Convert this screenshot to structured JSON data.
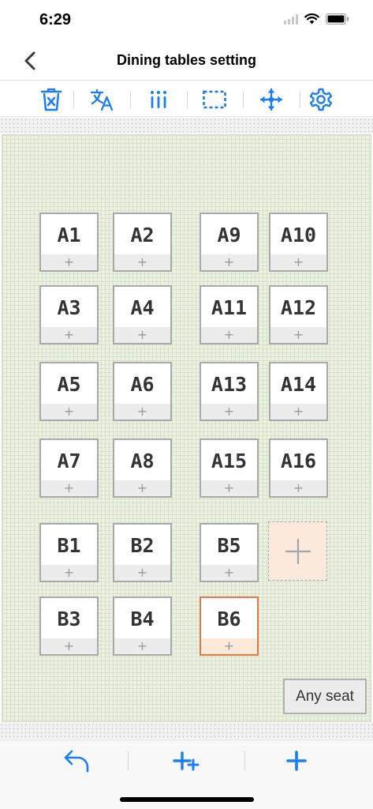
{
  "status_bar": {
    "time": "6:29"
  },
  "nav": {
    "title": "Dining tables setting"
  },
  "toolbar": {
    "tools": [
      {
        "icon": "trash-icon"
      },
      {
        "icon": "translate-icon"
      },
      {
        "icon": "columns-icon"
      },
      {
        "icon": "selection-icon"
      },
      {
        "icon": "move-icon"
      },
      {
        "icon": "gear-icon"
      }
    ]
  },
  "tables": {
    "add_label": "+",
    "items": [
      {
        "name": "A1"
      },
      {
        "name": "A2"
      },
      {
        "name": "A9"
      },
      {
        "name": "A10"
      },
      {
        "name": "A3"
      },
      {
        "name": "A4"
      },
      {
        "name": "A11"
      },
      {
        "name": "A12"
      },
      {
        "name": "A5"
      },
      {
        "name": "A6"
      },
      {
        "name": "A13"
      },
      {
        "name": "A14"
      },
      {
        "name": "A7"
      },
      {
        "name": "A8"
      },
      {
        "name": "A15"
      },
      {
        "name": "A16"
      },
      {
        "name": "B1"
      },
      {
        "name": "B2"
      },
      {
        "name": "B5"
      },
      {
        "name": "B3"
      },
      {
        "name": "B4"
      },
      {
        "name": "B6",
        "selected": true
      }
    ]
  },
  "any_seat": {
    "label": "Any seat"
  },
  "colors": {
    "accent": "#1a7ef2",
    "selected_border": "#e07a45",
    "selected_fill": "#fde9d9"
  },
  "bottom_bar": {
    "buttons": [
      {
        "icon": "undo-icon"
      },
      {
        "icon": "add-multiple-icon"
      },
      {
        "icon": "add-icon"
      }
    ]
  }
}
